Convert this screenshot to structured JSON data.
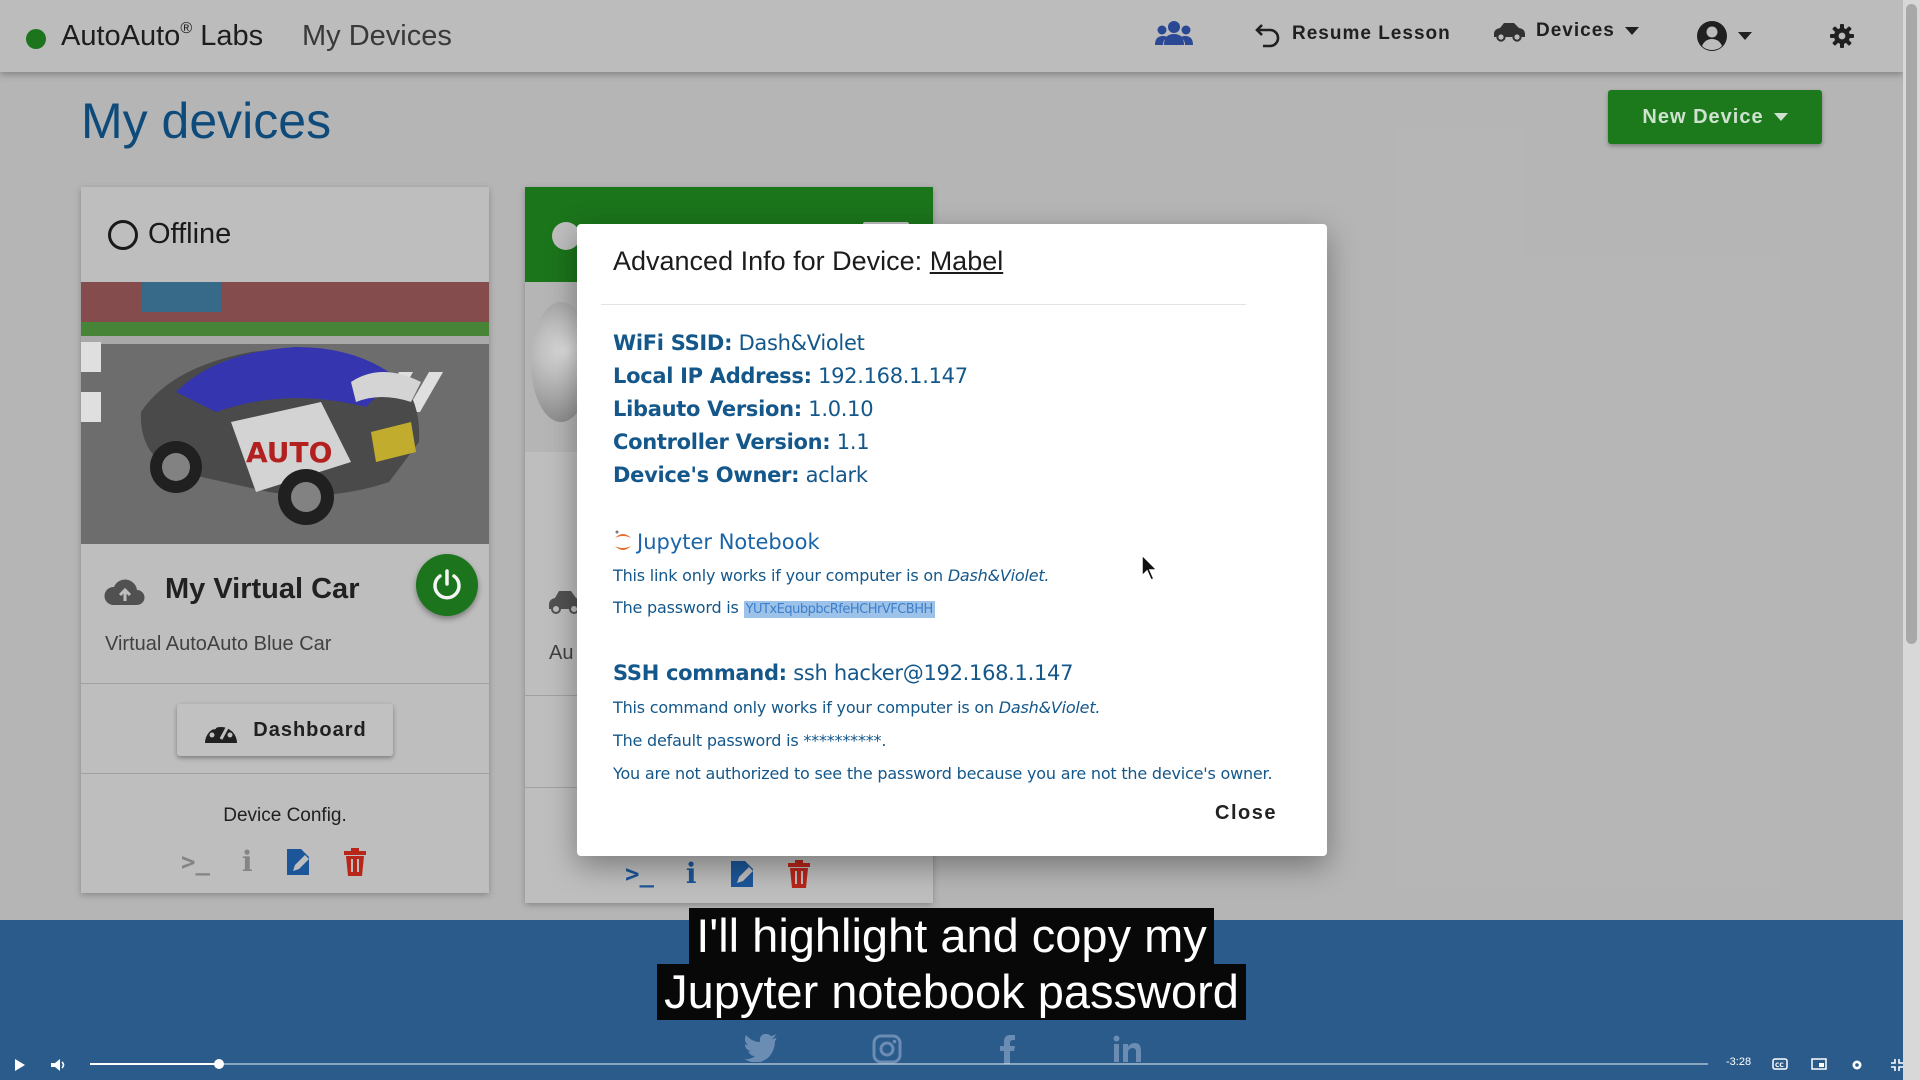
{
  "header": {
    "brand": "AutoAuto",
    "brand_reg": "®",
    "brand_suffix": "Labs",
    "breadcrumb": "My Devices",
    "resume_label": "Resume Lesson",
    "devices_label": "Devices"
  },
  "page": {
    "title": "My devices",
    "new_device_label": "New Device"
  },
  "device_card": {
    "status": "Offline",
    "name": "My Virtual Car",
    "subtitle": "Virtual AutoAuto Blue Car",
    "dashboard_label": "Dashboard",
    "config_label": "Device Config."
  },
  "device_card_2": {
    "subtitle_fragment": "Au"
  },
  "dialog": {
    "title_prefix": "Advanced Info for Device:",
    "device_name": "Mabel",
    "wifi_label": "WiFi SSID:",
    "wifi_value": "Dash&Violet",
    "ip_label": "Local IP Address:",
    "ip_value": "192.168.1.147",
    "libauto_label": "Libauto Version:",
    "libauto_value": "1.0.10",
    "controller_label": "Controller Version:",
    "controller_value": "1.1",
    "owner_label": "Device's Owner:",
    "owner_value": "aclark",
    "jupyter_label": "Jupyter Notebook",
    "jupyter_note_prefix": "This link only works if your computer is on",
    "jupyter_note_network": "Dash&Violet.",
    "password_prefix": "The password is",
    "password_value": "YUTxEqubpbcRfeHCHrVFCBHH",
    "ssh_label": "SSH command:",
    "ssh_value": "ssh hacker@192.168.1.147",
    "ssh_note_prefix": "This command only works if your computer is on",
    "ssh_note_network": "Dash&Violet.",
    "default_pw": "The default password is **********.",
    "not_authorized": "You are not authorized to see the password because you are not the device's owner.",
    "close_label": "Close"
  },
  "caption": {
    "line1": "I'll highlight and copy my",
    "line2": "Jupyter notebook password"
  },
  "video": {
    "time_remaining": "-3:28",
    "progress_fraction": 0.08
  },
  "colors": {
    "accent_green": "#1e7f1e",
    "link_blue": "#14578a",
    "footer_blue": "#2a5b8a",
    "delete_red": "#c0271b"
  }
}
